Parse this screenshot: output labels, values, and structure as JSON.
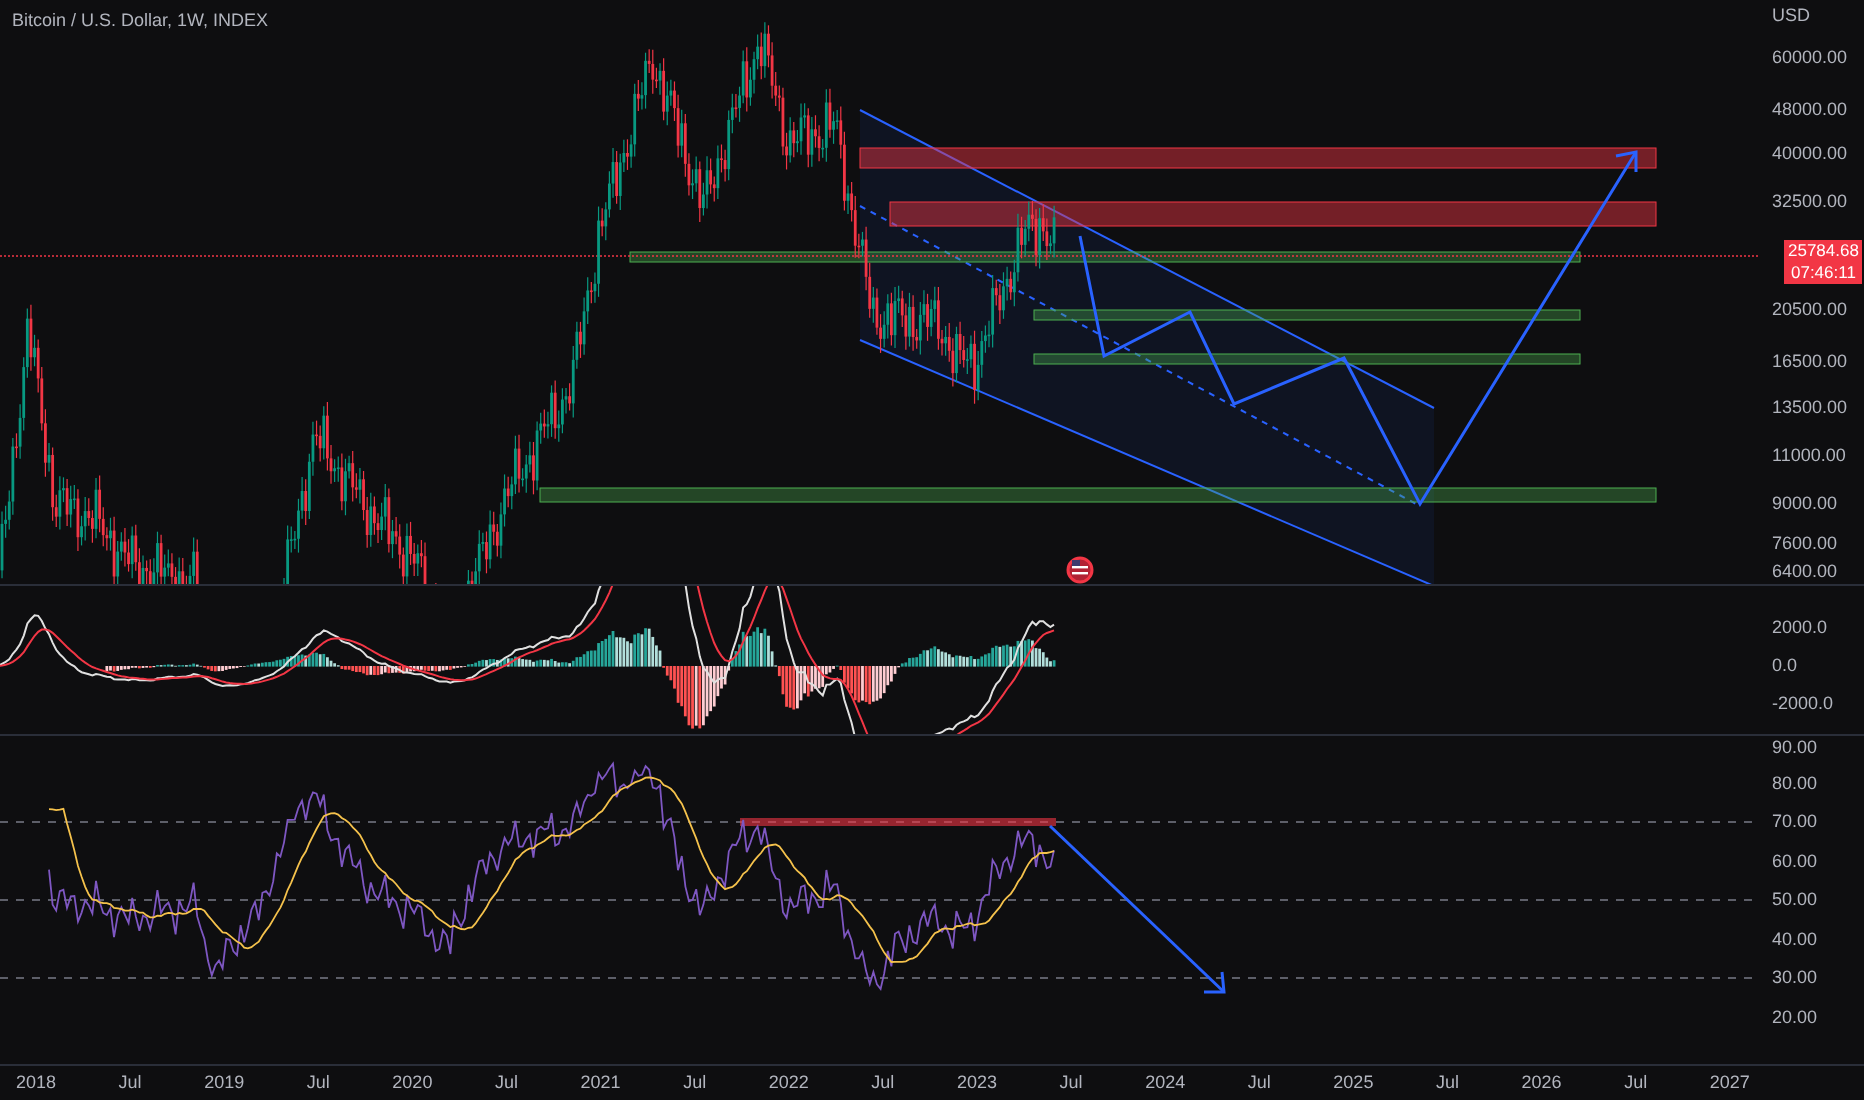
{
  "chart_title": "Bitcoin / U.S. Dollar, 1W, INDEX",
  "price_axis": {
    "unit": "USD",
    "labels": [
      "60000.00",
      "48000.00",
      "40000.00",
      "32500.00",
      "20500.00",
      "16500.00",
      "13500.00",
      "11000.00",
      "9000.00",
      "7600.00",
      "6400.00"
    ]
  },
  "last_price": {
    "price": "25784.68",
    "countdown": "07:46:11"
  },
  "macd_axis": {
    "labels": [
      "2000.0",
      "0.0",
      "-2000.0"
    ]
  },
  "rsi_axis": {
    "labels": [
      "90.00",
      "80.00",
      "70.00",
      "60.00",
      "50.00",
      "40.00",
      "30.00",
      "20.00"
    ]
  },
  "time_axis": {
    "labels": [
      "2018",
      "Jul",
      "2019",
      "Jul",
      "2020",
      "Jul",
      "2021",
      "Jul",
      "2022",
      "Jul",
      "2023",
      "Jul",
      "2024",
      "Jul",
      "2025",
      "Jul",
      "2026",
      "Jul",
      "2027"
    ]
  }
}
